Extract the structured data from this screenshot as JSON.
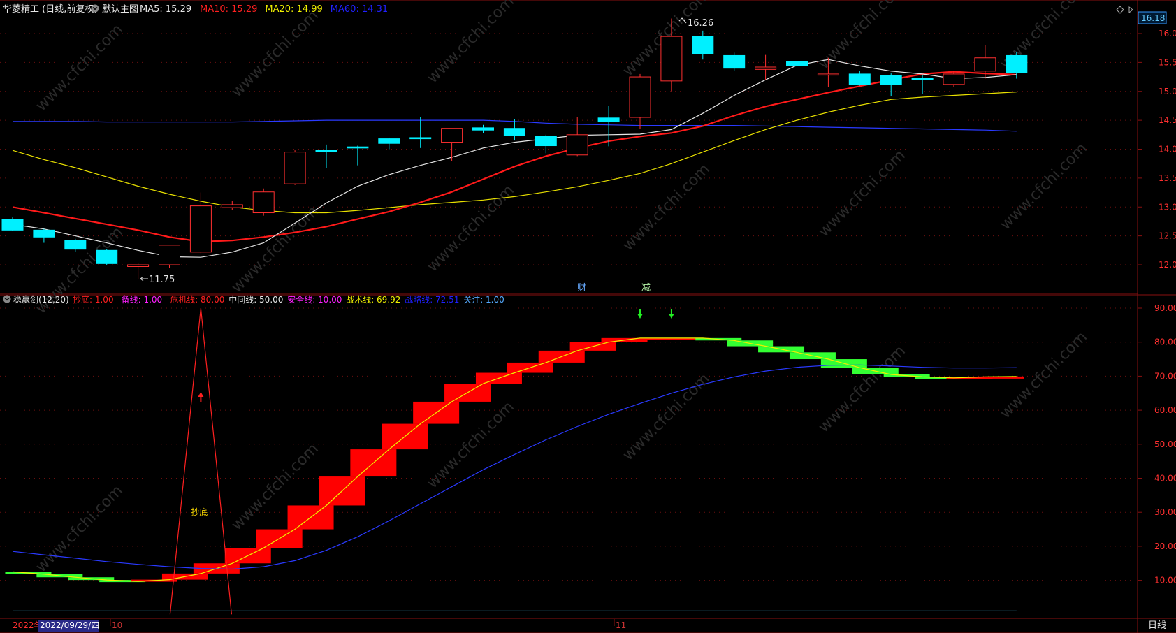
{
  "upper_panel": {
    "stock_title": "华菱精工 (日线,前复权)",
    "chart_menu": "默认主图",
    "ma_legend": [
      {
        "label": "MA5: 15.29",
        "color": "#e6e6e6"
      },
      {
        "label": "MA10: 15.29",
        "color": "#ff2020"
      },
      {
        "label": "MA20: 14.99",
        "color": "#f0f000"
      },
      {
        "label": "MA60: 14.31",
        "color": "#2020ff"
      }
    ],
    "price_ticks": [
      "16.00",
      "15.50",
      "15.00",
      "14.50",
      "14.00",
      "13.50",
      "13.00",
      "12.50",
      "12.00"
    ],
    "current_price_tag": "16.18",
    "high_label": "16.26",
    "low_label": "11.75",
    "event_labels": [
      "财",
      "减"
    ]
  },
  "lower_panel": {
    "indicator_title": "稳赢剑(12,20)",
    "legend": [
      {
        "label": "抄底: 1.00",
        "color": "#ff2020"
      },
      {
        "label": "备线: 1.00",
        "color": "#ff20ff"
      },
      {
        "label": "危机线: 80.00",
        "color": "#ff2020"
      },
      {
        "label": "中间线: 50.00",
        "color": "#e6e6e6"
      },
      {
        "label": "安全线: 10.00",
        "color": "#ff20ff"
      },
      {
        "label": "战术线: 69.92",
        "color": "#f0f000"
      },
      {
        "label": "战略线: 72.51",
        "color": "#2020ff"
      },
      {
        "label": "关注: 1.00",
        "color": "#55aaff"
      }
    ],
    "value_ticks": [
      "90.00",
      "80.00",
      "70.00",
      "60.00",
      "50.00",
      "40.00",
      "30.00",
      "20.00",
      "10.00"
    ],
    "signal_label": "抄底"
  },
  "time_axis": {
    "year_label": "2022年",
    "cursor_date": "2022/09/29/四",
    "month_labels": [
      "10",
      "11"
    ],
    "period_button": "日线"
  },
  "watermark": "www.cfchi.com",
  "chart_data": {
    "type": "candlestick",
    "candles": [
      {
        "o": 12.78,
        "h": 12.82,
        "l": 12.58,
        "c": 12.6
      },
      {
        "o": 12.6,
        "h": 12.62,
        "l": 12.38,
        "c": 12.48
      },
      {
        "o": 12.42,
        "h": 12.45,
        "l": 12.22,
        "c": 12.27
      },
      {
        "o": 12.25,
        "h": 12.27,
        "l": 12.0,
        "c": 12.02
      },
      {
        "o": 11.97,
        "h": 12.03,
        "l": 11.75,
        "c": 12.0
      },
      {
        "o": 12.0,
        "h": 12.34,
        "l": 11.95,
        "c": 12.34
      },
      {
        "o": 12.22,
        "h": 13.25,
        "l": 12.2,
        "c": 13.02
      },
      {
        "o": 12.99,
        "h": 13.1,
        "l": 12.95,
        "c": 13.04
      },
      {
        "o": 12.9,
        "h": 13.32,
        "l": 12.85,
        "c": 13.26
      },
      {
        "o": 13.4,
        "h": 13.98,
        "l": 13.38,
        "c": 13.95
      },
      {
        "o": 13.98,
        "h": 14.08,
        "l": 13.67,
        "c": 13.96
      },
      {
        "o": 14.04,
        "h": 14.06,
        "l": 13.72,
        "c": 14.02
      },
      {
        "o": 14.18,
        "h": 14.2,
        "l": 14.0,
        "c": 14.1
      },
      {
        "o": 14.2,
        "h": 14.55,
        "l": 14.02,
        "c": 14.18
      },
      {
        "o": 14.12,
        "h": 14.22,
        "l": 13.8,
        "c": 14.36
      },
      {
        "o": 14.37,
        "h": 14.42,
        "l": 14.28,
        "c": 14.33
      },
      {
        "o": 14.36,
        "h": 14.52,
        "l": 14.15,
        "c": 14.24
      },
      {
        "o": 14.22,
        "h": 14.25,
        "l": 13.93,
        "c": 14.06
      },
      {
        "o": 13.9,
        "h": 14.55,
        "l": 13.88,
        "c": 14.25
      },
      {
        "o": 14.54,
        "h": 14.75,
        "l": 14.05,
        "c": 14.48
      },
      {
        "o": 14.55,
        "h": 15.3,
        "l": 14.35,
        "c": 15.25
      },
      {
        "o": 15.18,
        "h": 16.26,
        "l": 15.0,
        "c": 15.95
      },
      {
        "o": 15.95,
        "h": 16.05,
        "l": 15.55,
        "c": 15.65
      },
      {
        "o": 15.62,
        "h": 15.67,
        "l": 15.35,
        "c": 15.4
      },
      {
        "o": 15.38,
        "h": 15.63,
        "l": 15.2,
        "c": 15.42
      },
      {
        "o": 15.52,
        "h": 15.55,
        "l": 15.4,
        "c": 15.44
      },
      {
        "o": 15.28,
        "h": 15.58,
        "l": 15.08,
        "c": 15.3
      },
      {
        "o": 15.3,
        "h": 15.35,
        "l": 15.1,
        "c": 15.12
      },
      {
        "o": 15.27,
        "h": 15.31,
        "l": 14.92,
        "c": 15.12
      },
      {
        "o": 15.23,
        "h": 15.28,
        "l": 14.96,
        "c": 15.2
      },
      {
        "o": 15.12,
        "h": 15.35,
        "l": 15.08,
        "c": 15.3
      },
      {
        "o": 15.35,
        "h": 15.8,
        "l": 15.22,
        "c": 15.58
      },
      {
        "o": 15.62,
        "h": 15.68,
        "l": 15.22,
        "c": 15.32
      }
    ],
    "ma5": [
      12.7,
      12.62,
      12.5,
      12.38,
      12.25,
      12.14,
      12.13,
      12.22,
      12.38,
      12.72,
      13.07,
      13.36,
      13.56,
      13.72,
      13.86,
      14.02,
      14.12,
      14.18,
      14.24,
      14.25,
      14.26,
      14.34,
      14.62,
      14.93,
      15.2,
      15.45,
      15.55,
      15.44,
      15.35,
      15.3,
      15.22,
      15.24,
      15.29
    ],
    "ma10": [
      13.0,
      12.9,
      12.8,
      12.7,
      12.6,
      12.48,
      12.4,
      12.42,
      12.48,
      12.56,
      12.66,
      12.79,
      12.92,
      13.08,
      13.26,
      13.48,
      13.7,
      13.88,
      14.02,
      14.14,
      14.22,
      14.28,
      14.4,
      14.58,
      14.74,
      14.86,
      14.98,
      15.09,
      15.2,
      15.3,
      15.34,
      15.31,
      15.29
    ],
    "ma20": [
      13.98,
      13.82,
      13.68,
      13.52,
      13.36,
      13.22,
      13.1,
      13.0,
      12.94,
      12.9,
      12.9,
      12.94,
      12.99,
      13.04,
      13.08,
      13.12,
      13.18,
      13.26,
      13.35,
      13.46,
      13.58,
      13.75,
      13.95,
      14.15,
      14.34,
      14.5,
      14.64,
      14.76,
      14.86,
      14.9,
      14.93,
      14.96,
      14.99
    ],
    "ma60": [
      14.48,
      14.48,
      14.48,
      14.47,
      14.47,
      14.47,
      14.47,
      14.47,
      14.48,
      14.49,
      14.5,
      14.5,
      14.5,
      14.5,
      14.5,
      14.5,
      14.48,
      14.45,
      14.43,
      14.42,
      14.41,
      14.41,
      14.41,
      14.41,
      14.4,
      14.39,
      14.38,
      14.37,
      14.36,
      14.35,
      14.34,
      14.33,
      14.31
    ],
    "indicator": {
      "tactic": [
        12.5,
        11.8,
        10.9,
        10.1,
        9.7,
        10.2,
        12.0,
        15.0,
        19.5,
        25.0,
        32.0,
        40.5,
        48.5,
        56.0,
        62.5,
        67.8,
        71.0,
        74.0,
        77.5,
        80.0,
        81.2,
        81.2,
        81.2,
        80.5,
        78.8,
        77.0,
        75.0,
        72.5,
        70.5,
        69.8,
        69.5,
        69.8,
        69.9
      ],
      "strategy": [
        18.5,
        17.5,
        16.5,
        15.5,
        14.7,
        14.0,
        13.5,
        13.3,
        14.0,
        15.8,
        18.8,
        22.8,
        27.5,
        32.5,
        37.5,
        42.5,
        47.0,
        51.3,
        55.2,
        58.8,
        62.0,
        65.0,
        67.6,
        69.8,
        71.5,
        72.6,
        73.2,
        73.3,
        73.0,
        72.6,
        72.4,
        72.4,
        72.5
      ],
      "safety_line": 1.0,
      "signal_spike_index": 6,
      "signal_spike_value": 90,
      "up_arrow_index": 6,
      "down_arrow_indices": [
        20,
        21
      ],
      "ylim": [
        0,
        95
      ]
    }
  }
}
